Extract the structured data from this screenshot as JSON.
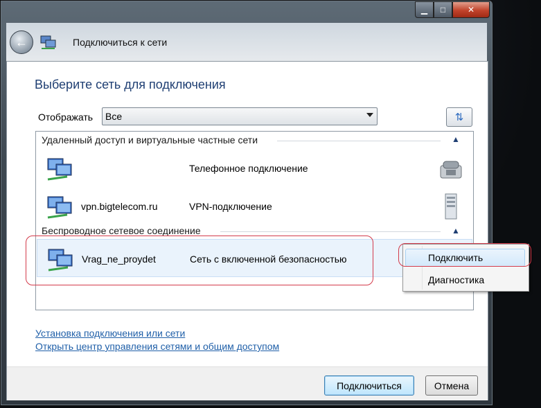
{
  "window": {
    "title": "Подключиться к сети",
    "controls": {
      "minimize": "▁",
      "maximize": "□",
      "close": "✕"
    }
  },
  "heading": "Выберите сеть для подключения",
  "filter": {
    "label": "Отображать",
    "value": "Все"
  },
  "groups": [
    {
      "title": "Удаленный доступ и виртуальные частные сети",
      "items": [
        {
          "name": "",
          "type": "Телефонное подключение",
          "icon": "phone-icon"
        },
        {
          "name": "vpn.bigtelecom.ru",
          "type": "VPN-подключение",
          "icon": "server-icon"
        }
      ]
    },
    {
      "title": "Беспроводное сетевое соединение",
      "items": [
        {
          "name": "Vrag_ne_proydet",
          "type": "Сеть с включенной безопасностью",
          "icon": "wireless-network-icon",
          "selected": true
        }
      ]
    }
  ],
  "context_menu": {
    "items": [
      "Подключить",
      "Диагностика"
    ],
    "highlighted": 0
  },
  "links": {
    "setup": "Установка подключения или сети",
    "center": "Открыть центр управления сетями и общим доступом"
  },
  "buttons": {
    "connect": "Подключиться",
    "cancel": "Отмена"
  },
  "colors": {
    "heading": "#1f3f73",
    "link": "#1f5fa8",
    "annotation": "#d33a4a"
  }
}
